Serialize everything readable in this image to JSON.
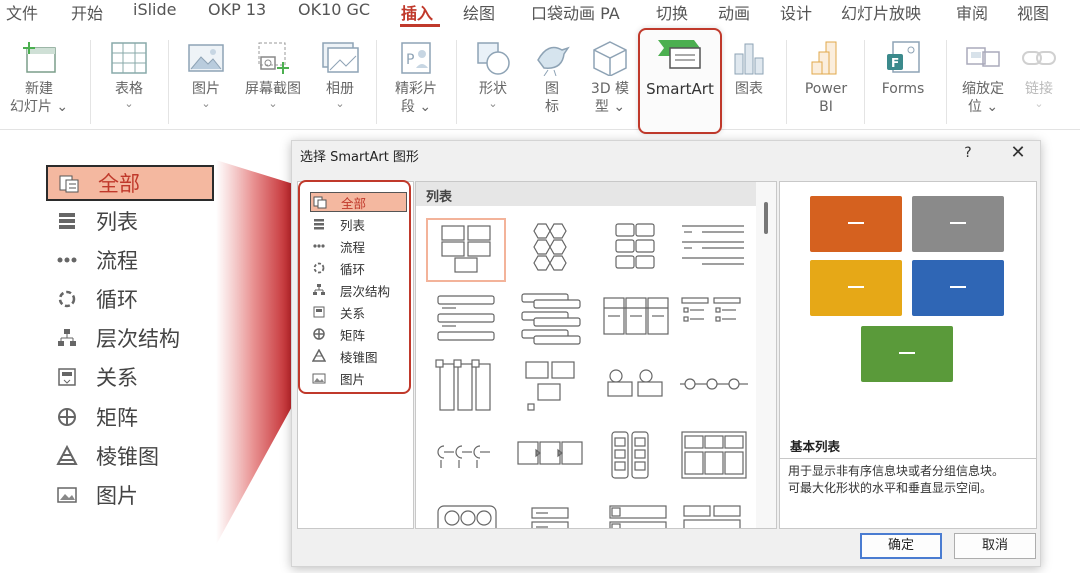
{
  "menu": {
    "tabs": [
      "文件",
      "开始",
      "iSlide",
      "OKP 13",
      "OK10 GC",
      "插入",
      "绘图",
      "口袋动画 PA",
      "切换",
      "动画",
      "设计",
      "幻灯片放映",
      "审阅",
      "视图"
    ],
    "active_tab": "插入"
  },
  "ribbon": {
    "new_slide": "新建\n幻灯片",
    "new_slide_line1": "新建",
    "new_slide_line2": "幻灯片",
    "table": "表格",
    "picture": "图片",
    "screenshot": "屏幕截图",
    "album": "相册",
    "highlight_line1": "精彩片",
    "highlight_line2": "段",
    "shapes": "形状",
    "icons_line1": "图",
    "icons_line2": "标",
    "model3d_line1": "3D 模",
    "model3d_line2": "型",
    "smartart": "SmartArt",
    "chart": "图表",
    "powerbi_line1": "Power",
    "powerbi_line2": "BI",
    "forms": "Forms",
    "zoom_line1": "缩放定",
    "zoom_line2": "位",
    "link": "链接"
  },
  "zoom_list": {
    "items": [
      "全部",
      "列表",
      "流程",
      "循环",
      "层次结构",
      "关系",
      "矩阵",
      "棱锥图",
      "图片"
    ],
    "selected_index": 0
  },
  "dialog": {
    "title": "选择 SmartArt 图形",
    "help": "?",
    "close": "✕",
    "categories": [
      "全部",
      "列表",
      "流程",
      "循环",
      "层次结构",
      "关系",
      "矩阵",
      "棱锥图",
      "图片"
    ],
    "selected_category": "全部",
    "list_header": "列表",
    "preview": {
      "colors": [
        "#d5611f",
        "#8a8a8a",
        "#e6a817",
        "#2f66b5",
        "#5a9a3a"
      ],
      "title": "基本列表",
      "description_line1": "用于显示非有序信息块或者分组信息块。",
      "description_line2": "可最大化形状的水平和垂直显示空间。"
    },
    "ok_button": "确定",
    "cancel_button": "取消"
  },
  "colors": {
    "accent_red": "#c0392b",
    "selection_fill": "#f4b8a0"
  }
}
